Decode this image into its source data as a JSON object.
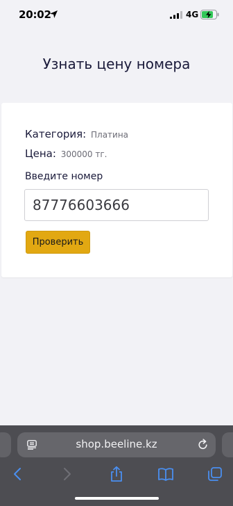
{
  "status_bar": {
    "time": "20:02",
    "network": "4G"
  },
  "page": {
    "title": "Узнать цену номера",
    "category_label": "Категория:",
    "category_value": "Платина",
    "price_label": "Цена:",
    "price_value": "300000 тг.",
    "input_label": "Введите номер",
    "input_value": "87776603666",
    "check_button": "Проверить"
  },
  "browser": {
    "url": "shop.beeline.kz"
  },
  "colors": {
    "background": "#f2f2f6",
    "button": "#e2a812",
    "browser_bar": "#4d4d52",
    "toolbar_icon": "#4a8ff0",
    "battery_charge": "#34c759"
  },
  "icons": [
    "location-arrow-icon",
    "cellular-signal-icon",
    "battery-charging-icon",
    "reader-mode-icon",
    "reload-icon",
    "back-icon",
    "forward-icon",
    "share-icon",
    "bookmarks-icon",
    "tabs-icon"
  ]
}
